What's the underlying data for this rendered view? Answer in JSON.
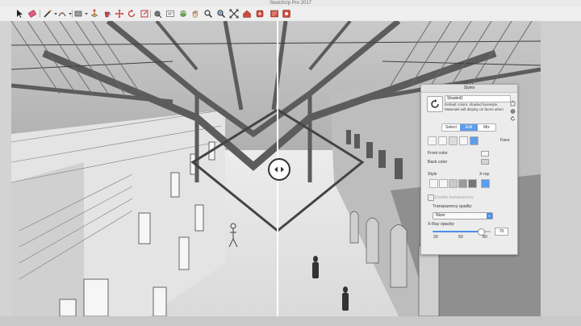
{
  "window": {
    "title": "SketchUp Pro 2017"
  },
  "toolbar": {
    "tools": [
      "select-tool",
      "eraser-tool",
      "line-tool",
      "shape-tool",
      "push-pull-tool",
      "move-tool",
      "rotate-tool",
      "scale-tool",
      "offset-tool",
      "tape-measure-tool",
      "paint-bucket-tool",
      "orbit-tool",
      "pan-tool",
      "zoom-tool",
      "zoom-extents-tool",
      "section-tool",
      "warehouse-tool",
      "extension-tool"
    ]
  },
  "styles_panel": {
    "title": "Styles",
    "style_name": "Shaded1",
    "description": "Default colors, shaded facestyle. Materials will display on faces when",
    "tabs": [
      {
        "label": "Select",
        "active": false
      },
      {
        "label": "Edit",
        "active": true
      },
      {
        "label": "Mix",
        "active": false
      }
    ],
    "section_label": "Face",
    "front_color_label": "Front color",
    "back_color_label": "Back color",
    "style_label": "Style",
    "xray_label": "X-ray",
    "transparency_checkbox_label": "Enable transparency",
    "transparency_quality_label": "Transparency quality:",
    "transparency_quality_value": "Nicer",
    "xray_opacity_label": "X-Ray opacity:",
    "xray_opacity_value": "70",
    "xray_opacity_fraction": 0.83,
    "scale_labels": [
      "20",
      "50",
      "80"
    ],
    "accent_color": "#4b8fe8"
  }
}
